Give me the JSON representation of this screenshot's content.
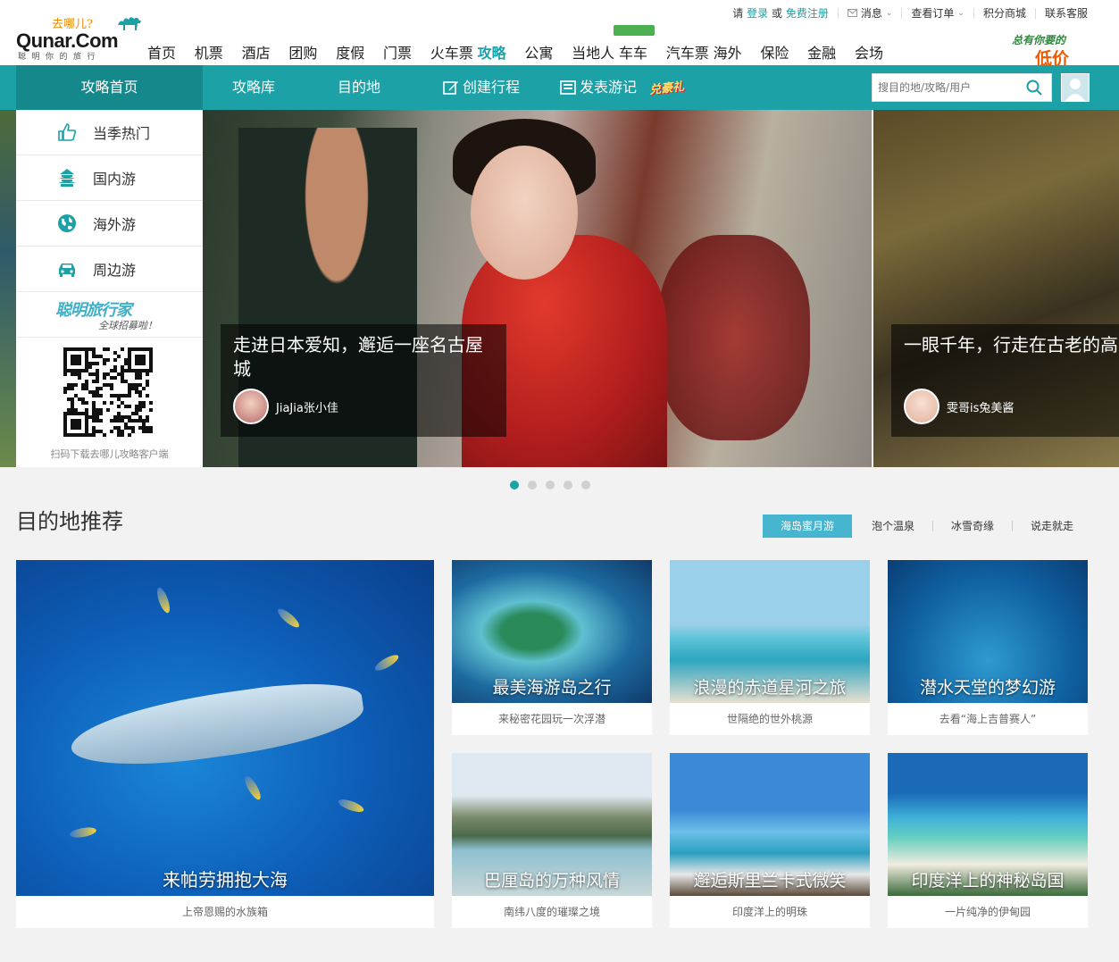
{
  "logo": {
    "slogan": "去哪儿?",
    "brand": "Qunar.Com",
    "tagline": "聪明你的旅行"
  },
  "main_nav": [
    "首页",
    "机票",
    "酒店",
    "团购",
    "度假",
    "门票",
    "火车票",
    "攻略",
    "公寓",
    "当地人",
    "车车",
    "汽车票",
    "海外",
    "保险",
    "金融",
    "会场"
  ],
  "main_nav_active": "攻略",
  "utility": {
    "please": "请",
    "login": "登录",
    "or": "或",
    "register": "免费注册",
    "messages": "消息",
    "orders": "查看订单",
    "points_mall": "积分商城",
    "support": "联系客服"
  },
  "promo": {
    "line1": "总有你要的",
    "line2": "低价"
  },
  "sub_nav": {
    "home": "攻略首页",
    "library": "攻略库",
    "destination": "目的地",
    "create": "创建行程",
    "post": "发表游记",
    "badge": "兑豪礼"
  },
  "search": {
    "placeholder": "搜目的地/攻略/用户"
  },
  "hero_menu": [
    {
      "label": "当季热门",
      "icon": "thumbs-up-icon"
    },
    {
      "label": "国内游",
      "icon": "pagoda-icon"
    },
    {
      "label": "海外游",
      "icon": "globe-icon"
    },
    {
      "label": "周边游",
      "icon": "car-icon"
    }
  ],
  "recruit": {
    "title": "聪明旅行家",
    "subtitle": "全球招募啦！"
  },
  "qr_caption": "扫码下载去哪儿攻略客户端",
  "slides": [
    {
      "title": "走进日本爱知，邂逅一座名古屋城",
      "user": "JiaJia张小佳"
    },
    {
      "title": "一眼千年，行走在古老的高",
      "user": "雯哥is兔美酱"
    }
  ],
  "slide_dots": 5,
  "slide_active": 0,
  "section": {
    "title": "目的地推荐",
    "tabs": [
      "海岛蜜月游",
      "泡个温泉",
      "冰雪奇缘",
      "说走就走"
    ],
    "active_tab": 0
  },
  "cards": [
    {
      "title": "来帕劳拥抱大海",
      "subtitle": "上帝恩赐的水族箱"
    },
    {
      "title": "最美海游岛之行",
      "subtitle": "来秘密花园玩一次浮潜"
    },
    {
      "title": "浪漫的赤道星河之旅",
      "subtitle": "世隔绝的世外桃源"
    },
    {
      "title": "潜水天堂的梦幻游",
      "subtitle": "去看“海上吉普赛人”"
    },
    {
      "title": "巴厘岛的万种风情",
      "subtitle": "南纬八度的璀璨之境"
    },
    {
      "title": "邂逅斯里兰卡式微笑",
      "subtitle": "印度洋上的明珠"
    },
    {
      "title": "印度洋上的神秘岛国",
      "subtitle": "一片纯净的伊甸园"
    }
  ],
  "colors": {
    "teal": "#1ba1a6",
    "teal_dark": "#15888c",
    "tab_active": "#45b5d0",
    "orange": "#f05a00"
  }
}
